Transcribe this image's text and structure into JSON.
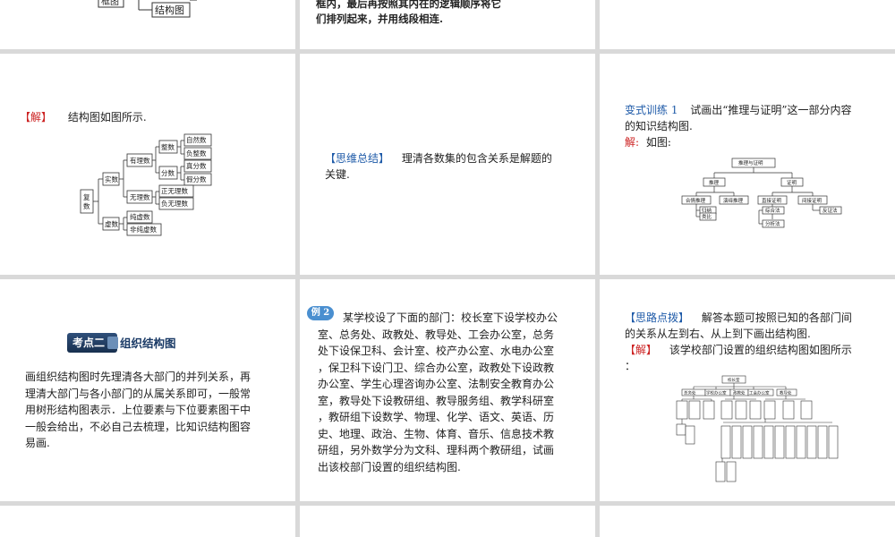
{
  "top_row": {
    "partial_node_left": "框图",
    "partial_node_right": "结构图",
    "instruction_line1": "框内，最后再按照其内在的逻辑顺序将它",
    "instruction_line2": "们排列起来，并用线段相连."
  },
  "solution1": {
    "tag": "【解】",
    "text": "结构图如图所示.",
    "tree": {
      "root": "复数",
      "real": "实数",
      "imag": "虚数",
      "rational": "有理数",
      "irrational": "无理数",
      "integer": "整数",
      "fraction": "分数",
      "natural": "自然数",
      "neg_int": "负整数",
      "pos_frac": "真分数",
      "false_frac": "假分数",
      "pos_irr": "正无理数",
      "neg_irr": "负无理数",
      "pure_imag": "纯虚数",
      "nonpure_imag": "非纯虚数"
    }
  },
  "summary": {
    "tag": "【思维总结】",
    "text": "理清各数集的包含关系是解题的",
    "text2": "关键."
  },
  "variant": {
    "tag": "变式训练 1",
    "text1": "试画出“推理与证明”这一部分内容",
    "text2": "的知识结构图.",
    "answer_tag": "解:",
    "answer_text": "如图:",
    "tree": {
      "root": "推理与证明",
      "reasoning": "推理",
      "proof": "证明",
      "plausible": "合情推理",
      "deductive": "演绎推理",
      "direct": "直接证明",
      "indirect": "间接证明",
      "induction": "归纳",
      "analogy": "类比",
      "synthesis": "综合法",
      "analysis": "分析法",
      "contradiction": "反证法"
    }
  },
  "section2": {
    "badge": "考点二",
    "title": "组织结构图",
    "para": [
      "画组织结构图时先理清各大部门的并列关系，再",
      "理清大部门与各小部门的从属关系即可，一般常",
      "用树形结构图表示．上位要素与下位要素图干中",
      "一般会给出，不必自己去梳理，比知识结构图容",
      "易画."
    ]
  },
  "example2": {
    "badge": "例 2",
    "lines": [
      "某学校设了下面的部门：校长室下设学校办公",
      "室、总务处、政教处、教导处、工会办公室，总务",
      "处下设保卫科、会计室、校产办公室、水电办公室",
      "，保卫科下设门卫、综合办公室，政教处下设政教",
      "办公室、学生心理咨询办公室、法制安全教育办公",
      "室，教导处下设教研组、教导服务组、教学科研室",
      "，教研组下设数学、物理、化学、语文、英语、历",
      "史、地理、政治、生物、体育、音乐、信息技术教",
      "研组，另外数学分为文科、理科两个教研组，试画",
      "出该校部门设置的组织结构图."
    ]
  },
  "hint": {
    "tag": "【思路点拨】",
    "text1": "解答本题可按照已知的各部门间",
    "text2": "的关系从左到右、从上到下画出结构图.",
    "answer_tag": "【解】",
    "answer_text": "该学校部门设置的组织结构图如图所示",
    "answer_tail": "：",
    "org": {
      "root": "校长室",
      "level1": [
        "总务处",
        "学校办公室",
        "政教处",
        "工会办公室",
        "教导处"
      ]
    }
  },
  "colors": {
    "red": "#cc2222",
    "blue": "#1e5aa8",
    "badge": "#18304f"
  }
}
